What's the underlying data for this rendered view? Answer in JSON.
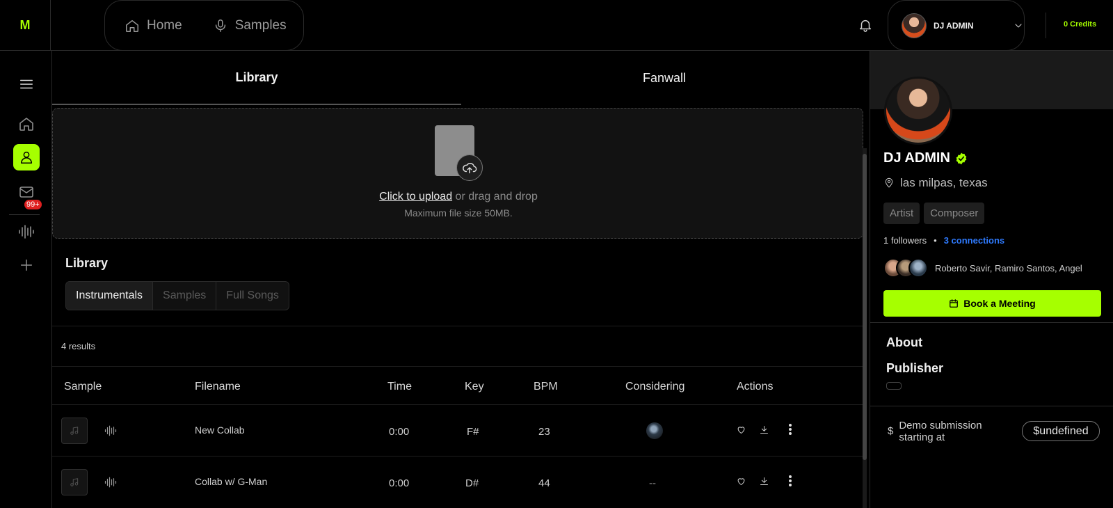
{
  "brand": {
    "logo_text": "M",
    "accent": "#a6ff00"
  },
  "top_nav": {
    "home_label": "Home",
    "samples_label": "Samples"
  },
  "user_menu": {
    "name": "DJ ADMIN",
    "credits": "0 Credits"
  },
  "sidebar": {
    "inbox_badge": "99+"
  },
  "tabs": [
    {
      "label": "Library",
      "active": true
    },
    {
      "label": "Fanwall",
      "active": false
    }
  ],
  "upload": {
    "link_text": "Click to upload",
    "rest_text": " or drag and drop",
    "max_size": "Maximum file size 50MB."
  },
  "library": {
    "title": "Library",
    "segments": [
      {
        "label": "Instrumentals",
        "active": true
      },
      {
        "label": "Samples",
        "active": false
      },
      {
        "label": "Full Songs",
        "active": false
      }
    ],
    "results": "4 results",
    "columns": [
      "Sample",
      "Filename",
      "Time",
      "Key",
      "BPM",
      "Considering",
      "Actions"
    ],
    "rows": [
      {
        "filename": "New Collab",
        "time": "0:00",
        "key": "F#",
        "bpm": "23",
        "considering": ""
      },
      {
        "filename": "Collab w/ G-Man",
        "time": "0:00",
        "key": "D#",
        "bpm": "44",
        "considering": "--"
      }
    ]
  },
  "profile": {
    "name": "DJ ADMIN",
    "location": "las milpas, texas",
    "tags": [
      "Artist",
      "Composer"
    ],
    "followers": "1 followers",
    "connections": "3 connections",
    "connection_names": "Roberto Savir, Ramiro Santos, Angel",
    "book_label": "Book a Meeting",
    "about_label": "About",
    "publisher_label": "Publisher",
    "demo_dollar": "$",
    "demo_text": "Demo submission starting at",
    "demo_price": "$undefined"
  }
}
